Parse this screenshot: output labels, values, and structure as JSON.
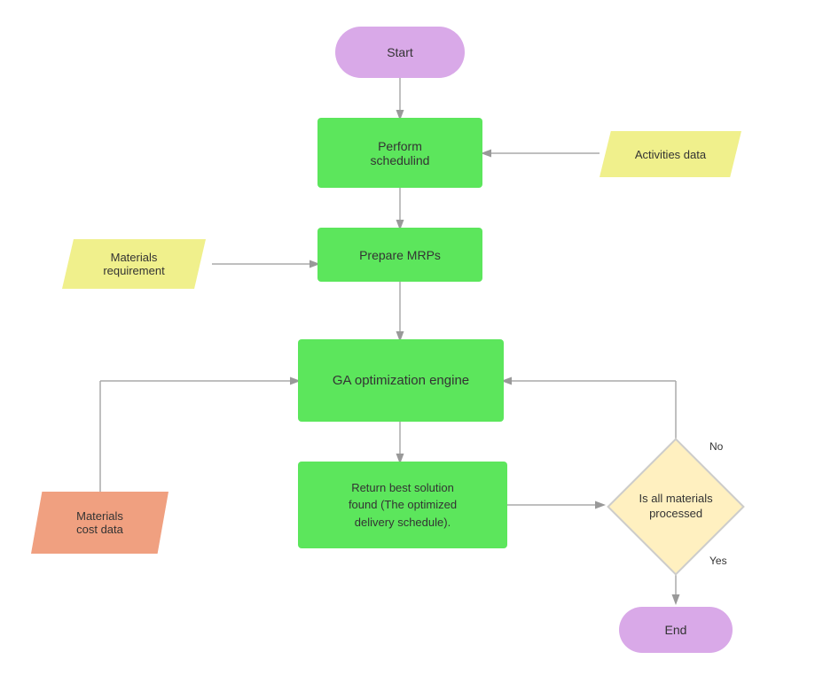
{
  "nodes": {
    "start": {
      "label": "Start"
    },
    "perform": {
      "label": "Perform\nschedulind"
    },
    "prepare": {
      "label": "Prepare MRPs"
    },
    "ga": {
      "label": "GA optimization engine"
    },
    "return": {
      "label": "Return best solution\nfound (The optimized\ndelivery schedule)."
    },
    "end": {
      "label": "End"
    },
    "activities": {
      "label": "Activities data"
    },
    "materials_req": {
      "label": "Materials\nrequirement"
    },
    "materials_cost": {
      "label": "Materials\ncost data"
    },
    "is_all": {
      "label": "Is all materials\nprocessed"
    }
  },
  "labels": {
    "no": "No",
    "yes": "Yes"
  }
}
